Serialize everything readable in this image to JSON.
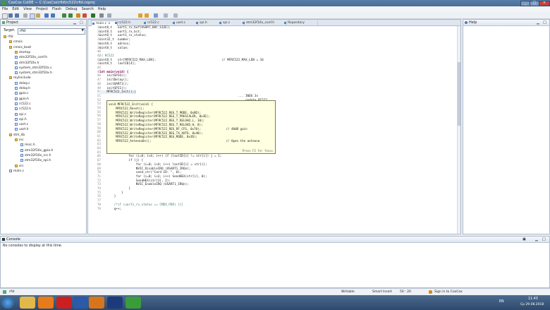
{
  "window": {
    "title": "CooCox CoIDE — C:\\CooCox\\rfid\\rc522\\rfid.coproj"
  },
  "menu": [
    "File",
    "Edit",
    "View",
    "Project",
    "Flash",
    "Debug",
    "Search",
    "Help"
  ],
  "project_panel": {
    "title": "Project",
    "target_label": "Target:",
    "target_value": "rfid",
    "tree": [
      {
        "label": "rfid",
        "level": 0,
        "type": "folder"
      },
      {
        "label": "cmsis",
        "level": 1,
        "type": "folder"
      },
      {
        "label": "cmsis_boot",
        "level": 1,
        "type": "folder"
      },
      {
        "label": "startup",
        "level": 2,
        "type": "folder"
      },
      {
        "label": "stm32f10x_conf.h",
        "level": 2,
        "type": "file"
      },
      {
        "label": "stm32f10x.h",
        "level": 2,
        "type": "file"
      },
      {
        "label": "system_stm32f10x.c",
        "level": 2,
        "type": "file"
      },
      {
        "label": "system_stm32f10x.h",
        "level": 2,
        "type": "file"
      },
      {
        "label": "mylinclude",
        "level": 1,
        "type": "folder"
      },
      {
        "label": "delay.c",
        "level": 2,
        "type": "file"
      },
      {
        "label": "delay.h",
        "level": 2,
        "type": "file"
      },
      {
        "label": "gpio.c",
        "level": 2,
        "type": "file"
      },
      {
        "label": "gpio.h",
        "level": 2,
        "type": "file"
      },
      {
        "label": "rc522.c",
        "level": 2,
        "type": "file"
      },
      {
        "label": "rc522.h",
        "level": 2,
        "type": "file"
      },
      {
        "label": "spi.c",
        "level": 2,
        "type": "file"
      },
      {
        "label": "spi.h",
        "level": 2,
        "type": "file"
      },
      {
        "label": "uart.c",
        "level": 2,
        "type": "file"
      },
      {
        "label": "uart.h",
        "level": 2,
        "type": "file"
      },
      {
        "label": "stm_lib",
        "level": 1,
        "type": "folder"
      },
      {
        "label": "inc",
        "level": 2,
        "type": "folder"
      },
      {
        "label": "misc.h",
        "level": 3,
        "type": "file"
      },
      {
        "label": "stm32f10x_gpio.h",
        "level": 3,
        "type": "file"
      },
      {
        "label": "stm32f10x_rcc.h",
        "level": 3,
        "type": "file"
      },
      {
        "label": "stm32f10x_spi.h",
        "level": 3,
        "type": "file"
      },
      {
        "label": "src",
        "level": 2,
        "type": "folder"
      },
      {
        "label": "main.c",
        "level": 1,
        "type": "file"
      }
    ]
  },
  "editor": {
    "tabs": [
      "main.c",
      "rc522.h",
      "rc522.c",
      "uart.c",
      "spi.h",
      "spi.c",
      "stm32f10x_conf.h",
      "Repository"
    ],
    "active_tab": 0,
    "lines": [
      {
        "n": "34",
        "t": "uint8_t   uart1_rx_buf[USART_BUF_SIZE];"
      },
      {
        "n": "35",
        "t": "uint8_t   uart1_rx_bit;"
      },
      {
        "n": "36",
        "t": "uint8_t   uart1_rx_status;"
      },
      {
        "n": "37",
        "t": "uint32_t  number;"
      },
      {
        "n": "38",
        "t": "uint8_t   adress;"
      },
      {
        "n": "39",
        "t": "uint8_t   value;"
      },
      {
        "n": "40",
        "t": ""
      },
      {
        "n": "41",
        "t": "// RC522",
        "c": "cm"
      },
      {
        "n": "42",
        "t": "uint8_t   str[MFRC522_MAX_LEN];                                    // MFRC522_MAX_LEN = 16"
      },
      {
        "n": "43",
        "t": "uint8_t   lastID[4];"
      },
      {
        "n": "44",
        "t": ""
      },
      {
        "n": "45",
        "t": "int main(void) {",
        "c": "kw"
      },
      {
        "n": "46",
        "t": "    initGPIO();"
      },
      {
        "n": "47",
        "t": "    initDelay();"
      },
      {
        "n": "48",
        "t": "    initUART1();"
      },
      {
        "n": "49",
        "t": "    initSPI1();"
      },
      {
        "n": "50",
        "t": "    MFRC522_Init();|"
      },
      {
        "n": "51",
        "t": "                                                                            ... IWDG 3s"
      },
      {
        "n": "52",
        "t": "                                                                            ... update RC522"
      },
      {
        "n": "53",
        "t": ""
      },
      {
        "n": "54",
        "t": ""
      },
      {
        "n": "55",
        "t": ""
      },
      {
        "n": "56",
        "t": ""
      },
      {
        "n": "57",
        "t": ""
      },
      {
        "n": "58",
        "t": ""
      },
      {
        "n": "59",
        "t": ""
      },
      {
        "n": "60",
        "t": "                                                                          and clear IWDG <3s"
      },
      {
        "n": "61",
        "t": ""
      },
      {
        "n": "62",
        "t": "        if (MFRC522_Request(PICC_REQIDL, str) == MI_OK) {"
      },
      {
        "n": "63",
        "t": "            if (!MFRC522_Anticoll(str)) {"
      },
      {
        "n": "64",
        "t": "                j = 0;"
      },
      {
        "n": "65",
        "t": "                q = 0;"
      },
      {
        "n": "66",
        "t": "                for (i=0; i<4; i++) if (lastID[i] != str[i]) j = 1;"
      },
      {
        "n": "67",
        "t": "                if (j) {"
      },
      {
        "n": "68",
        "t": "                    for (i=0; i<4; i++) lastID[i] = str[i];"
      },
      {
        "n": "69",
        "t": "                    NVIC_DisableIRQ (USART1_IRQn);"
      },
      {
        "n": "70",
        "t": "                    send_str(\"Card ID: \", 0);"
      },
      {
        "n": "71",
        "t": "                    for (i=0; i<3; i++) SendHEX(str[i], 0);"
      },
      {
        "n": "72",
        "t": "                    SendHEX(str[3], 2);"
      },
      {
        "n": "73",
        "t": "                    NVIC_EnableIRQ (USART1_IRQn);"
      },
      {
        "n": "74",
        "t": "                }"
      },
      {
        "n": "75",
        "t": "            }"
      },
      {
        "n": "76",
        "t": "        }"
      },
      {
        "n": "77",
        "t": ""
      },
      {
        "n": "78",
        "t": "        /*if (uart1_rx_status == CMDX_PDD) {[]",
        "c": "cm"
      },
      {
        "n": "79",
        "t": "        q++;"
      }
    ]
  },
  "popup": {
    "lines": [
      "void MFRC522_Init(void) {",
      "    MFRC522_Reset();",
      "    MFRC522_WriteRegister(MFRC522_REG_T_MODE, 0x8D);",
      "    MFRC522_WriteRegister(MFRC522_REG_T_PRESCALER, 0x3E);",
      "    MFRC522_WriteRegister(MFRC522_REG_T_RELOAD_L, 30);",
      "    MFRC522_WriteRegister(MFRC522_REG_T_RELOAD_H, 0);",
      "    MFRC522_WriteRegister(MFRC522_REG_RF_CFG, 0x70);              // 48dB gain",
      "    MFRC522_WriteRegister(MFRC522_REG_TX_AUTO, 0x40);",
      "    MFRC522_WriteRegister(MFRC522_REG_MODE, 0x3D);",
      "    MFRC522_AntennaOn();                                          // Open the antenna"
    ],
    "hint": "Press F2 for focus"
  },
  "help_panel": {
    "title": "Help"
  },
  "console": {
    "title": "Console",
    "message": "No consoles to display at this time."
  },
  "statusbar": {
    "file": "rfid",
    "mode": "Writable",
    "insert": "Smart Insert",
    "pos": "50 : 20",
    "signin": "Sign in to CooCox"
  },
  "taskbar": {
    "lang": "EN",
    "time": "11:43",
    "date": "Ср 29.08.2018"
  }
}
